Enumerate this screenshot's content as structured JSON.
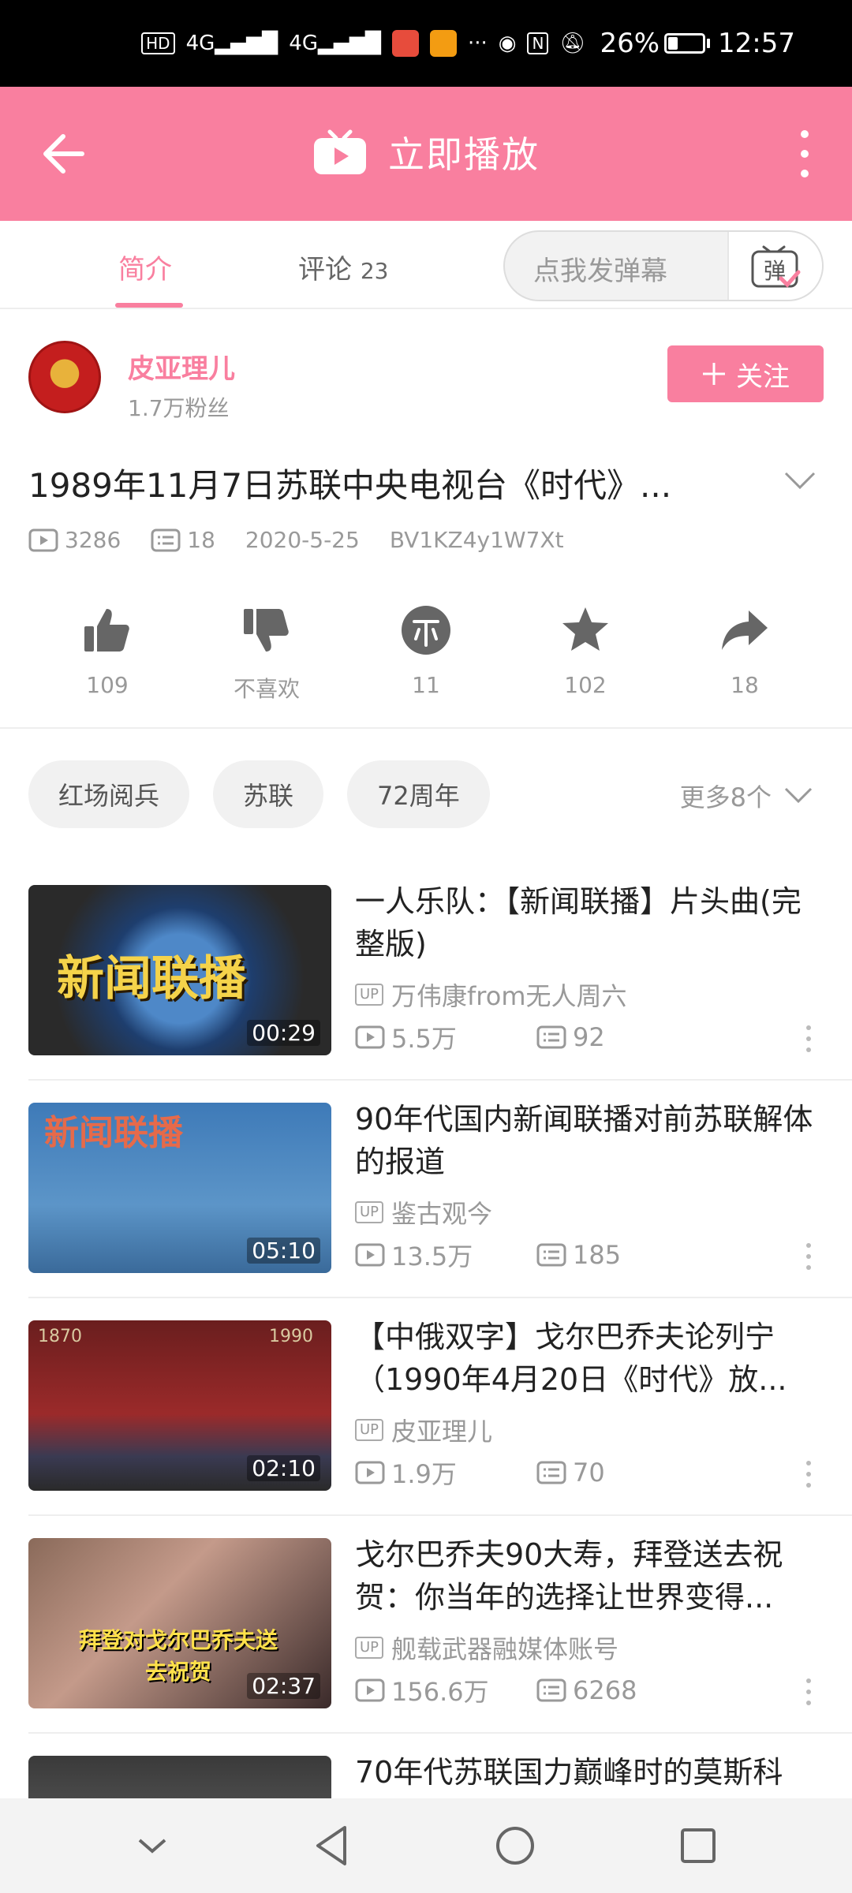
{
  "status_bar": {
    "hd": "HD",
    "net1": "4G",
    "net2": "4G",
    "extra": "···",
    "nfc": "N",
    "battery": "26%",
    "time": "12:57"
  },
  "header": {
    "title": "立即播放"
  },
  "tabs": {
    "intro": "简介",
    "comments": "评论",
    "comment_count": "23",
    "danmu_placeholder": "点我发弹幕",
    "danmu_button": "弹"
  },
  "uploader": {
    "name": "皮亚理儿",
    "fans": "1.7万粉丝",
    "follow_label": "关注"
  },
  "video": {
    "title": "1989年11月7日苏联中央电视台《时代》...",
    "plays": "3286",
    "danmaku": "18",
    "date": "2020-5-25",
    "bvid": "BV1KZ4y1W7Xt"
  },
  "actions": [
    {
      "icon": "thumbs-up-icon",
      "label": "109"
    },
    {
      "icon": "thumbs-down-icon",
      "label": "不喜欢"
    },
    {
      "icon": "coin-icon",
      "label": "11"
    },
    {
      "icon": "star-icon",
      "label": "102"
    },
    {
      "icon": "share-icon",
      "label": "18"
    }
  ],
  "tags": [
    "红场阅兵",
    "苏联",
    "72周年"
  ],
  "more_tags": "更多8个",
  "related": [
    {
      "title": "一人乐队：【新闻联播】片头曲(完整版)",
      "up": "万伟康from无人周六",
      "plays": "5.5万",
      "danmaku": "92",
      "duration": "00:29",
      "thumb_text": "新闻联播"
    },
    {
      "title": "90年代国内新闻联播对前苏联解体的报道",
      "up": "鉴古观今",
      "plays": "13.5万",
      "danmaku": "185",
      "duration": "05:10",
      "thumb_text": "新闻联播"
    },
    {
      "title": "【中俄双字】戈尔巴乔夫论列宁（1990年4月20日《时代》放...",
      "up": "皮亚理儿",
      "plays": "1.9万",
      "danmaku": "70",
      "duration": "02:10",
      "thumb_text": "1870 1990"
    },
    {
      "title": "戈尔巴乔夫90大寿，拜登送去祝贺：你当年的选择让世界变得...",
      "up": "舰载武器融媒体账号",
      "plays": "156.6万",
      "danmaku": "6268",
      "duration": "02:37",
      "thumb_text": "拜登对戈尔巴乔夫送去祝贺"
    },
    {
      "title": "70年代苏联国力巅峰时的莫斯科"
    }
  ],
  "up_badge": "UP"
}
